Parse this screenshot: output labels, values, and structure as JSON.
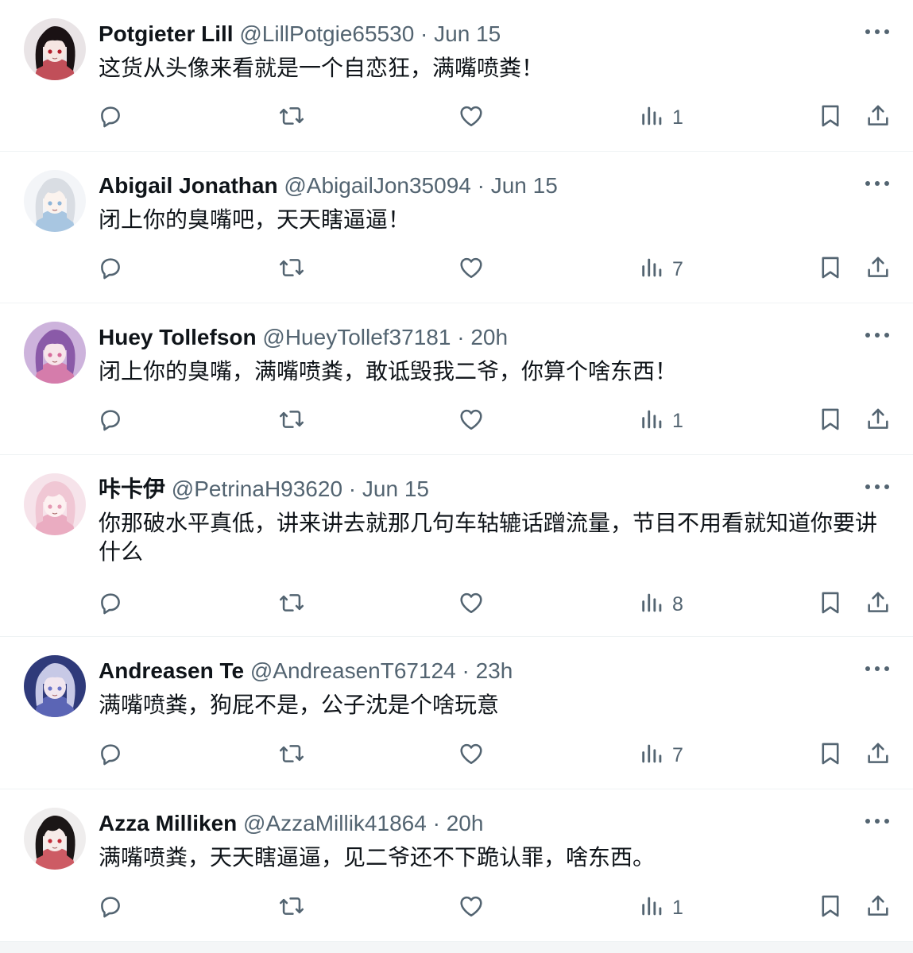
{
  "tweets": [
    {
      "name": "Potgieter Lill",
      "handle": "@LillPotgie65530",
      "sep": " · ",
      "time": "Jun 15",
      "text": "这货从头像来看就是一个自恋狂，满嘴喷粪！",
      "views": "1",
      "avatar_colors": {
        "bg": "#e9e4e6",
        "hair": "#1a1214",
        "face": "#f6e6e2",
        "accent": "#b31d2a"
      }
    },
    {
      "name": "Abigail Jonathan",
      "handle": "@AbigailJon35094",
      "sep": " · ",
      "time": "Jun 15",
      "text": "闭上你的臭嘴吧，天天瞎逼逼！",
      "views": "7",
      "avatar_colors": {
        "bg": "#f3f5f8",
        "hair": "#d9dde3",
        "face": "#fbf3ee",
        "accent": "#8fb6d9"
      }
    },
    {
      "name": "Huey Tollefson",
      "handle": "@HueyTollef37181",
      "sep": " · ",
      "time": "20h",
      "text": "闭上你的臭嘴，满嘴喷粪，敢诋毁我二爷，你算个啥东西！",
      "views": "1",
      "avatar_colors": {
        "bg": "#cdb3dc",
        "hair": "#8a5aa8",
        "face": "#f7e5ea",
        "accent": "#d76a9b"
      }
    },
    {
      "name": "咔卡伊",
      "handle": "@PetrinaH93620",
      "sep": " · ",
      "time": "Jun 15",
      "text": "你那破水平真低，讲来讲去就那几句车轱辘话蹭流量，节目不用看就知道你要讲什么",
      "views": "8",
      "avatar_colors": {
        "bg": "#f6e3ea",
        "hair": "#f0c7d4",
        "face": "#fdf1f1",
        "accent": "#e59ab3"
      }
    },
    {
      "name": "Andreasen Te",
      "handle": "@AndreasenT67124",
      "sep": " · ",
      "time": "23h",
      "text": "满嘴喷粪，狗屁不是，公子沈是个啥玩意",
      "views": "7",
      "avatar_colors": {
        "bg": "#2f3a7a",
        "hair": "#c7c9e6",
        "face": "#f1e6ef",
        "accent": "#6b74c9"
      }
    },
    {
      "name": "Azza Milliken",
      "handle": "@AzzaMillik41864",
      "sep": " · ",
      "time": "20h",
      "text": "满嘴喷粪，天天瞎逼逼，见二爷还不下跪认罪，啥东西。",
      "views": "1",
      "avatar_colors": {
        "bg": "#efeded",
        "hair": "#1b1616",
        "face": "#f7ebe8",
        "accent": "#c22a36"
      }
    }
  ],
  "icons": {
    "reply": "reply-icon",
    "retweet": "retweet-icon",
    "like": "like-icon",
    "views": "views-icon",
    "bookmark": "bookmark-icon",
    "share": "share-icon",
    "more": "more-icon"
  },
  "colors": {
    "text_primary": "#0f1419",
    "text_secondary": "#536471",
    "divider": "#eff3f4"
  }
}
